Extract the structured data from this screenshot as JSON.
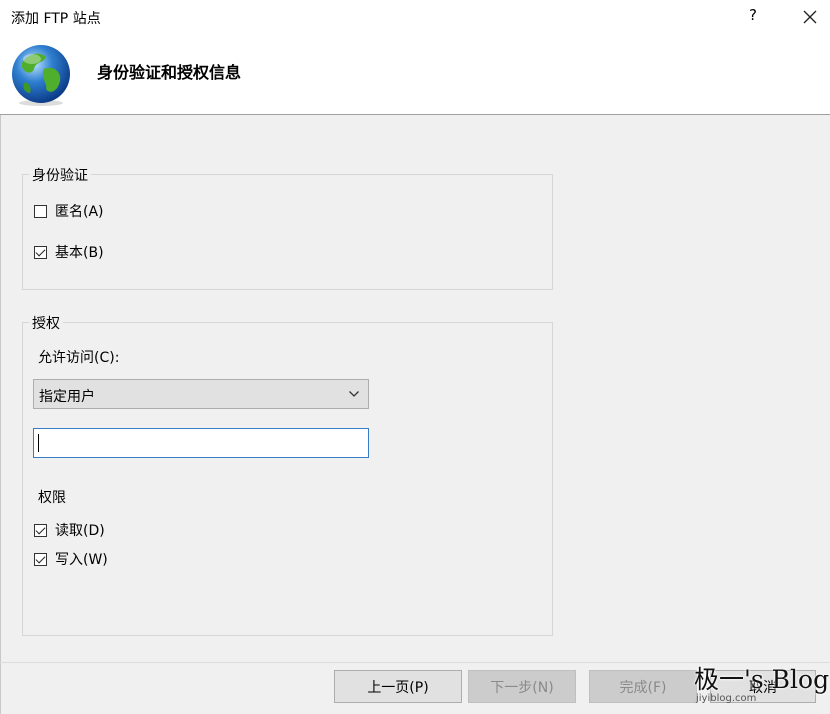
{
  "window": {
    "title": "添加 FTP 站点",
    "help_label": "?",
    "close_icon": "close-icon"
  },
  "header": {
    "title": "身份验证和授权信息",
    "icon": "globe-icon"
  },
  "authentication": {
    "label": "身份验证",
    "anonymous": {
      "label": "匿名(A)",
      "checked": false
    },
    "basic": {
      "label": "基本(B)",
      "checked": true
    }
  },
  "authorization": {
    "label": "授权",
    "allow_access_label": "允许访问(C):",
    "allow_access_value": "指定用户",
    "users_value": "",
    "permissions_label": "权限",
    "read": {
      "label": "读取(D)",
      "checked": true
    },
    "write": {
      "label": "写入(W)",
      "checked": true
    }
  },
  "buttons": {
    "previous": "上一页(P)",
    "next": "下一步(N)",
    "finish": "完成(F)",
    "cancel": "取消"
  },
  "watermark": {
    "text": "极一's Blog",
    "url": "jiyiblog.com"
  },
  "colors": {
    "dialog_bg": "#f0f0f0",
    "focus_border": "#3a7cc4",
    "globe_blue": "#2f7fd0",
    "globe_green": "#4fae2c"
  }
}
